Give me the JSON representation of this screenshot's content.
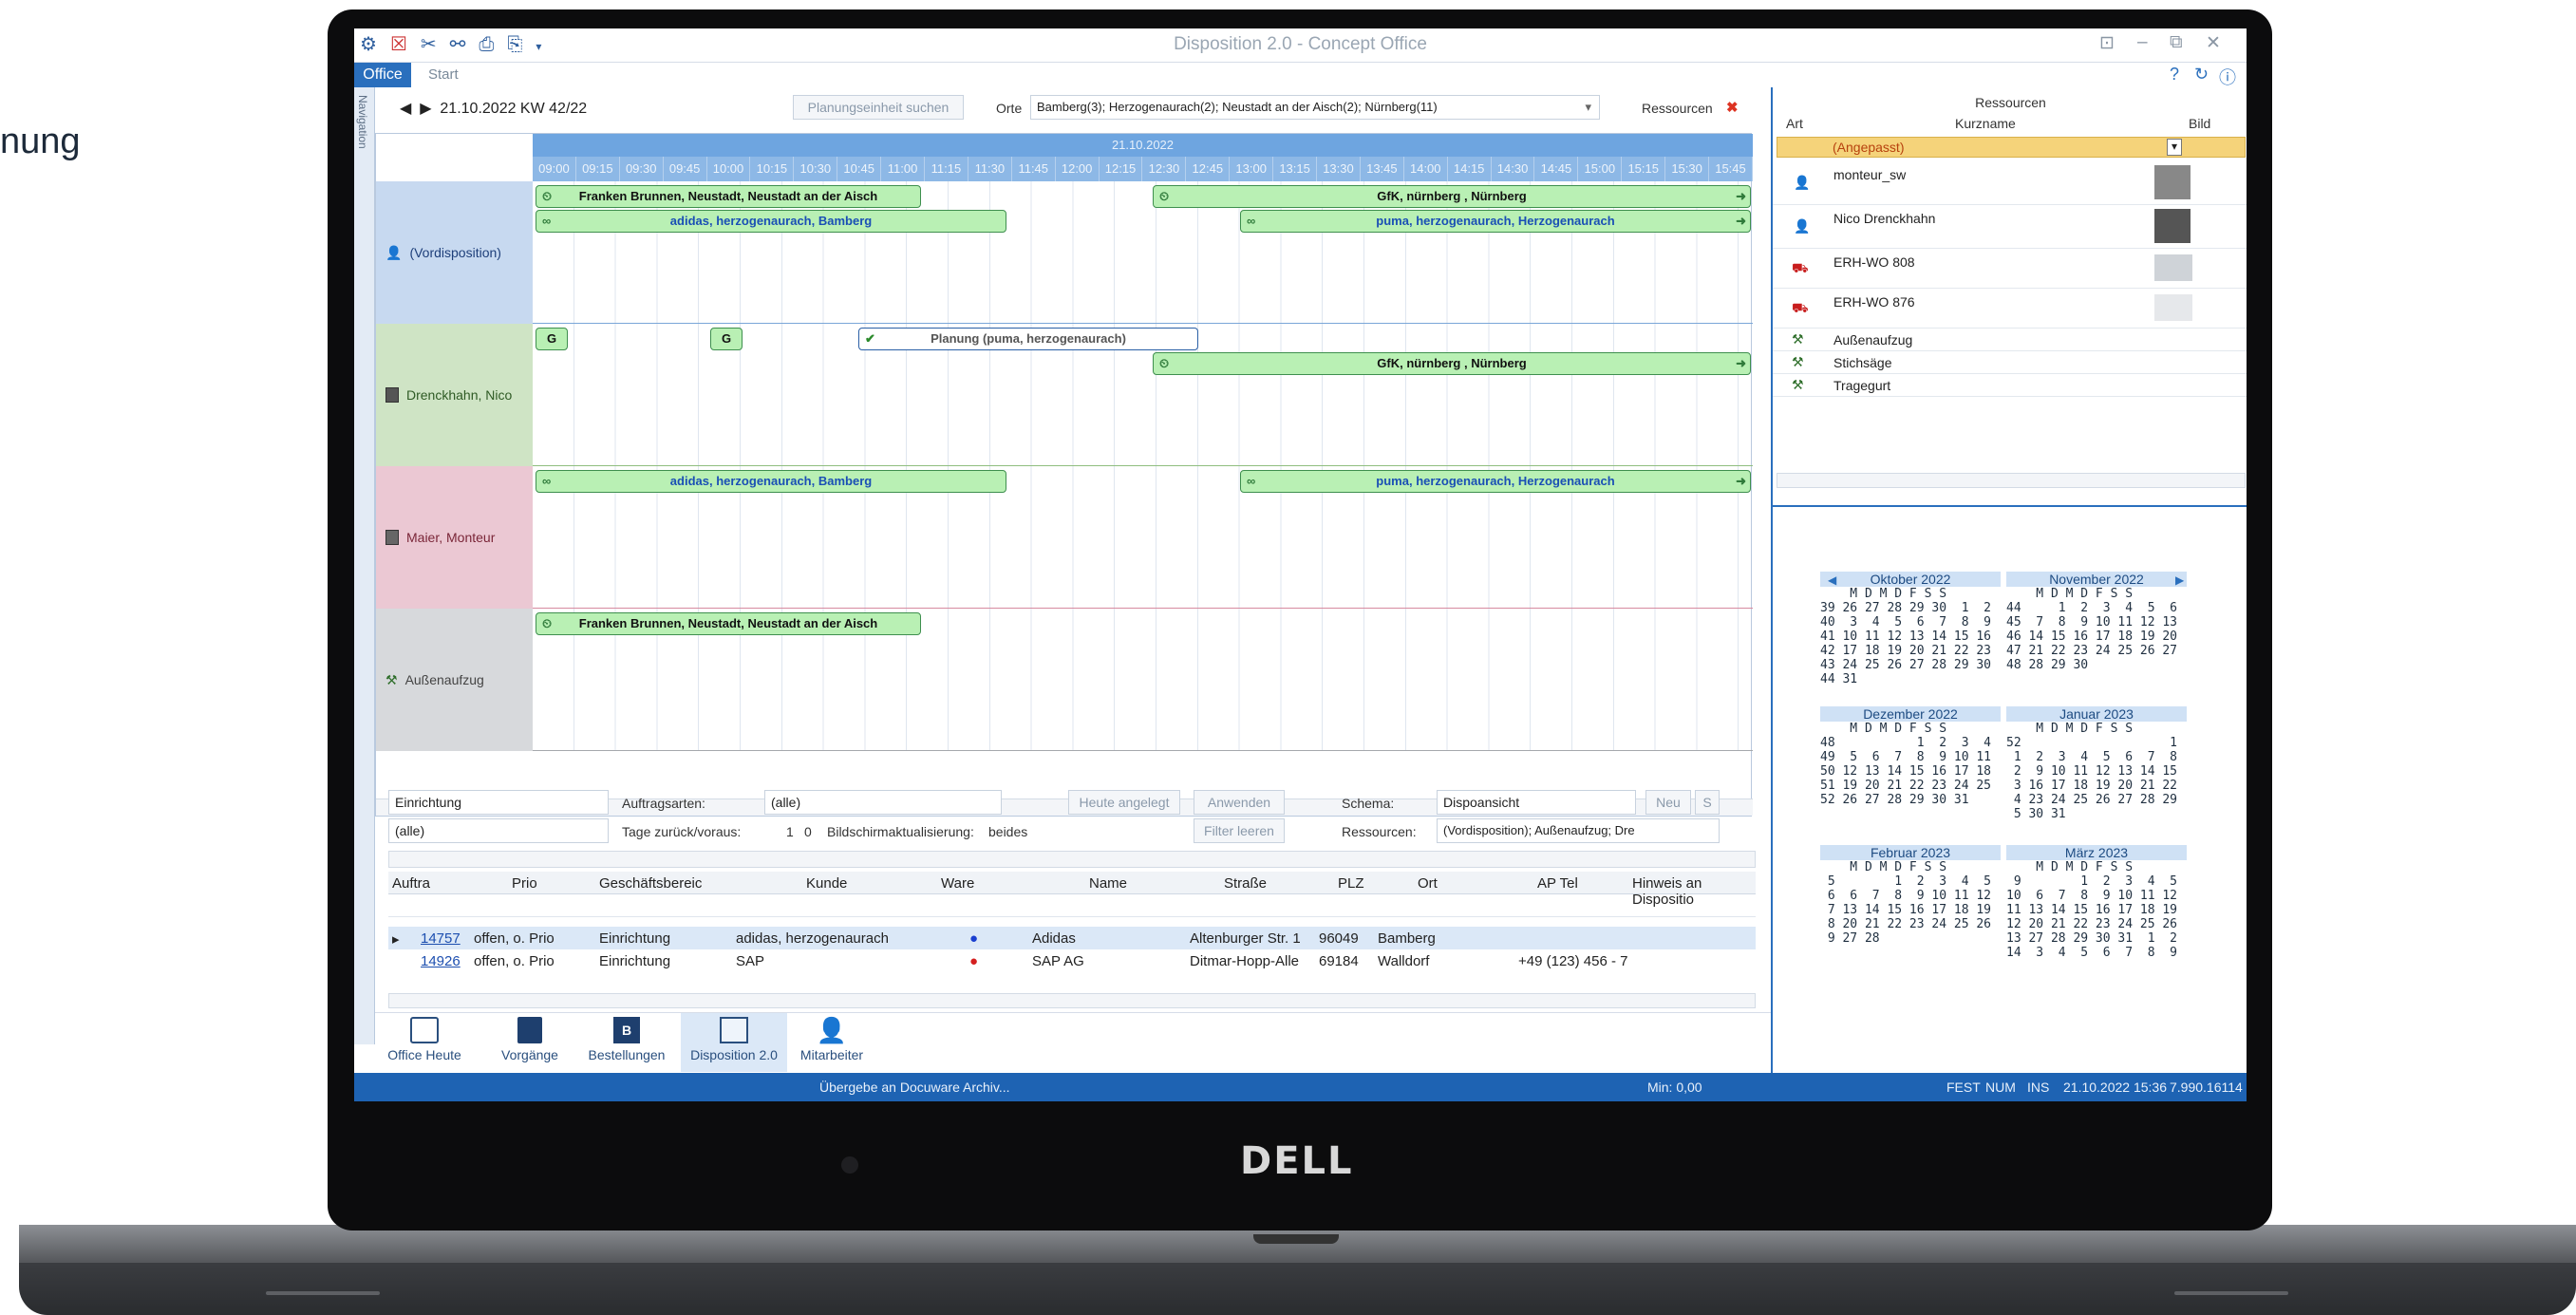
{
  "partial_heading": "nung",
  "device": {
    "brand": "DELL"
  },
  "app": {
    "title": "Disposition 2.0 - Concept Office",
    "tabs": [
      "Office",
      "Start"
    ],
    "nav_label": "Navigation"
  },
  "toolbar": {
    "date": "21.10.2022 KW 42/22",
    "search_button": "Planungseinheit suchen",
    "orte_label": "Orte",
    "orte_value": "Bamberg(3); Herzogenaurach(2); Neustadt an der Aisch(2); Nürnberg(11)",
    "ressourcen_label": "Ressourcen"
  },
  "planner": {
    "date_header": "21.10.2022",
    "hours": [
      "09:00",
      "09:15",
      "09:30",
      "09:45",
      "10:00",
      "10:15",
      "10:30",
      "10:45",
      "11:00",
      "11:15",
      "11:30",
      "11:45",
      "12:00",
      "12:15",
      "12:30",
      "12:45",
      "13:00",
      "13:15",
      "13:30",
      "13:45",
      "14:00",
      "14:15",
      "14:30",
      "14:45",
      "15:00",
      "15:15",
      "15:30",
      "15:45"
    ],
    "rows": [
      {
        "label": "(Vordisposition)",
        "icon": "person-icon"
      },
      {
        "label": "Drenckhahn, Nico",
        "icon": "photo-icon"
      },
      {
        "label": "Maier, Monteur",
        "icon": "photo-icon"
      },
      {
        "label": "Außenaufzug",
        "icon": "tool-icon"
      }
    ],
    "bars": {
      "b1": "Franken Brunnen, Neustadt, Neustadt an der Aisch",
      "b2": "GfK, nürnberg , Nürnberg",
      "b3": "adidas, herzogenaurach, Bamberg",
      "b4": "puma, herzogenaurach, Herzogenaurach",
      "b5": "G",
      "b6": "G",
      "b7": "Planung (puma, herzogenaurach)",
      "b8": "GfK, nürnberg , Nürnberg",
      "b9": "adidas, herzogenaurach, Bamberg",
      "b10": "puma, herzogenaurach, Herzogenaurach",
      "b11": "Franken Brunnen, Neustadt, Neustadt an der Aisch"
    }
  },
  "filters": {
    "f1": "Einrichtung",
    "f2": "(alle)",
    "auftragsarten_label": "Auftragsarten:",
    "auftragsarten_value": "(alle)",
    "tage_label": "Tage zurück/voraus:",
    "tage_back": "1",
    "tage_fwd": "0",
    "bildschirm_label": "Bildschirmaktualisierung:",
    "bildschirm_value": "beides",
    "heute_button": "Heute angelegt",
    "anwenden_button": "Anwenden",
    "filter_button": "Filter leeren",
    "schema_label": "Schema:",
    "schema_value": "Dispoansicht",
    "neu_button": "Neu",
    "s_button": "S",
    "ressourcen_label": "Ressourcen:",
    "ressourcen_value": "(Vordisposition); Außenaufzug; Dre"
  },
  "grid": {
    "headers": [
      "Auftra",
      "Prio",
      "Geschäftsbereic",
      "Kunde",
      "Ware",
      "Name",
      "Straße",
      "PLZ",
      "Ort",
      "AP Tel",
      "Hinweis an Dispositio"
    ],
    "rows": [
      {
        "auftrag": "14757",
        "prio": "offen, o. Prio",
        "bereich": "Einrichtung",
        "kunde": "adidas, herzogenaurach",
        "name": "Adidas",
        "strasse": "Altenburger Str. 1",
        "plz": "96049",
        "ort": "Bamberg",
        "tel": ""
      },
      {
        "auftrag": "14926",
        "prio": "offen, o. Prio",
        "bereich": "Einrichtung",
        "kunde": "SAP",
        "name": "SAP AG",
        "strasse": "Ditmar-Hopp-Alle",
        "plz": "69184",
        "ort": "Walldorf",
        "tel": "+49 (123) 456 - 7"
      }
    ]
  },
  "bottom_nav": [
    "Office Heute",
    "Vorgänge",
    "Bestellungen",
    "Disposition 2.0",
    "Mitarbeiter"
  ],
  "status": {
    "message": "Übergebe an Docuware Archiv...",
    "min": "Min: 0,00",
    "fest": "FEST",
    "num": "NUM",
    "ins": "INS",
    "datetime": "21.10.2022  15:36",
    "value": "7.990.16114"
  },
  "resources": {
    "title": "Ressourcen",
    "col_art": "Art",
    "col_kurzname": "Kurzname",
    "col_bild": "Bild",
    "filter": "(Angepasst)",
    "items": [
      "monteur_sw",
      "Nico Drenckhahn",
      "ERH-WO 808",
      "ERH-WO 876",
      "Außenaufzug",
      "Stichsäge",
      "Tragegurt"
    ]
  },
  "calendar": {
    "months": [
      {
        "title": "Oktober 2022",
        "body": "    M D M D F S S\n39 26 27 28 29 30  1  2\n40  3  4  5  6  7  8  9\n41 10 11 12 13 14 15 16\n42 17 18 19 20 21 22 23\n43 24 25 26 27 28 29 30\n44 31"
      },
      {
        "title": "November 2022",
        "body": "    M D M D F S S\n44     1  2  3  4  5  6\n45  7  8  9 10 11 12 13\n46 14 15 16 17 18 19 20\n47 21 22 23 24 25 26 27\n48 28 29 30"
      },
      {
        "title": "Dezember 2022",
        "body": "    M D M D F S S\n48           1  2  3  4\n49  5  6  7  8  9 10 11\n50 12 13 14 15 16 17 18\n51 19 20 21 22 23 24 25\n52 26 27 28 29 30 31"
      },
      {
        "title": "Januar 2023",
        "body": "    M D M D F S S\n52                    1\n 1  2  3  4  5  6  7  8\n 2  9 10 11 12 13 14 15\n 3 16 17 18 19 20 21 22\n 4 23 24 25 26 27 28 29\n 5 30 31"
      },
      {
        "title": "Februar 2023",
        "body": "    M D M D F S S\n 5        1  2  3  4  5\n 6  6  7  8  9 10 11 12\n 7 13 14 15 16 17 18 19\n 8 20 21 22 23 24 25 26\n 9 27 28"
      },
      {
        "title": "März 2023",
        "body": "    M D M D F S S\n 9        1  2  3  4  5\n10  6  7  8  9 10 11 12\n11 13 14 15 16 17 18 19\n12 20 21 22 23 24 25 26\n13 27 28 29 30 31  1  2\n14  3  4  5  6  7  8  9"
      }
    ]
  },
  "colors": {
    "accent": "#2a6fbd",
    "vordisp": "#c7d9f0",
    "drenckhahn": "#cfe4c5",
    "maier": "#ebc8d3",
    "aussen": "#d7d9dc",
    "bar": "#b9f0b4"
  }
}
